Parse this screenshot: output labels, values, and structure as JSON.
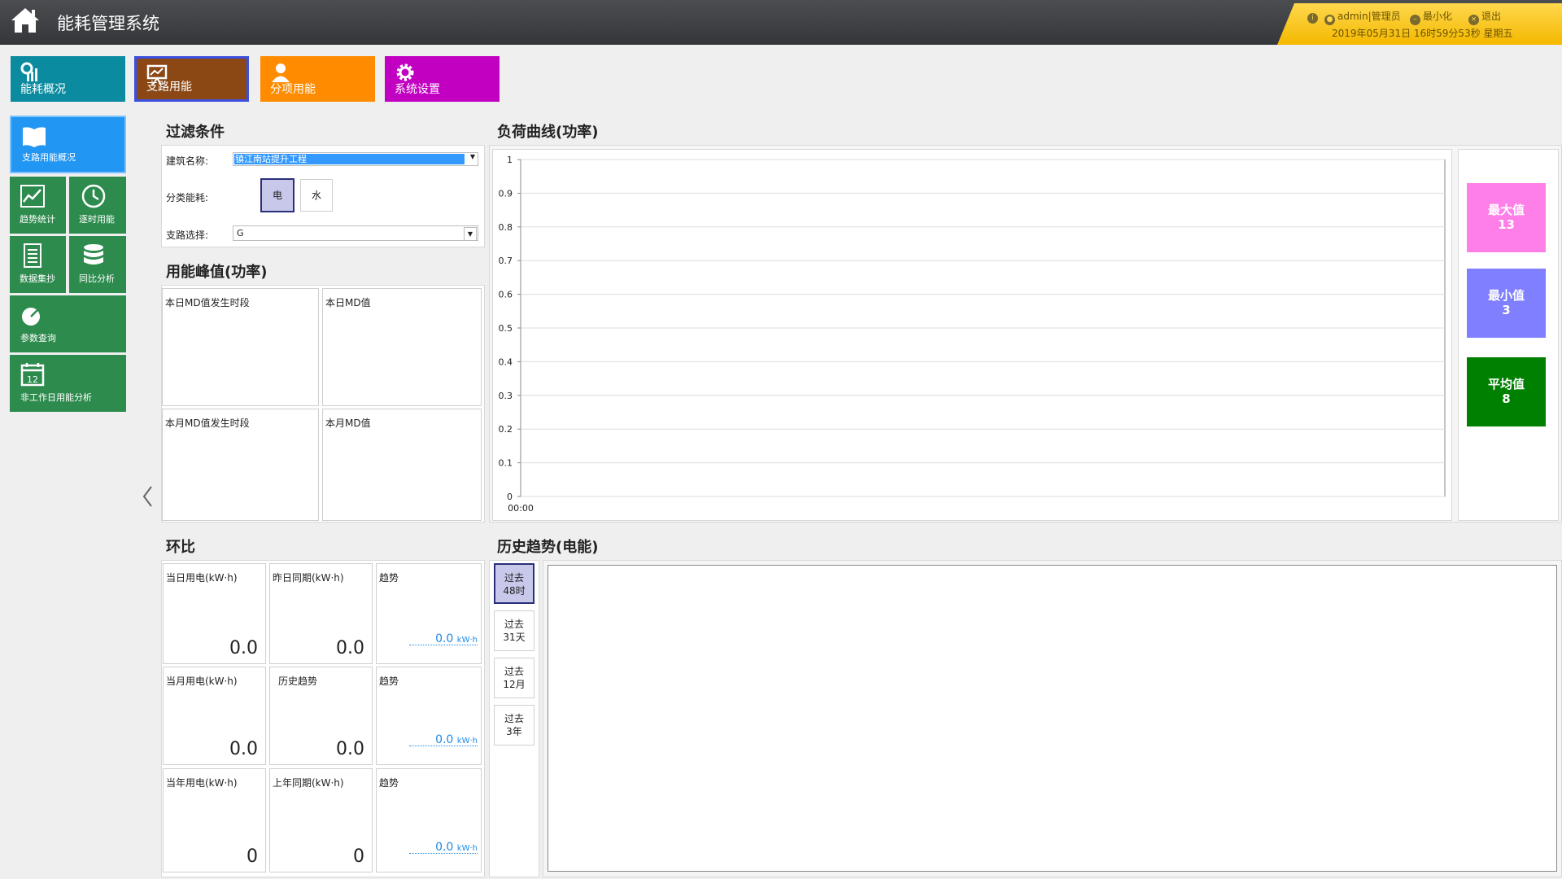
{
  "header": {
    "title": "能耗管理系统",
    "user": "admin|管理员",
    "minimize": "最小化",
    "logout": "退出",
    "datetime": "2019年05月31日 16时59分53秒 星期五"
  },
  "top_tabs": [
    {
      "label": "能耗概况"
    },
    {
      "label": "支路用能"
    },
    {
      "label": "分项用能"
    },
    {
      "label": "系统设置"
    }
  ],
  "side_menu": [
    {
      "label": "支路用能概况"
    },
    {
      "label": "趋势统计"
    },
    {
      "label": "逐时用能"
    },
    {
      "label": "数据集抄"
    },
    {
      "label": "同比分析"
    },
    {
      "label": "参数查询"
    },
    {
      "label": "非工作日用能分析"
    }
  ],
  "calendar_day": "12",
  "filter": {
    "title": "过滤条件",
    "building_label": "建筑名称:",
    "building_value": "镇江南站提升工程",
    "category_label": "分类能耗:",
    "elec": "电",
    "water": "水",
    "branch_label": "支路选择:",
    "branch_value": "G"
  },
  "peak": {
    "title": "用能峰值(功率)",
    "cells": [
      "本日MD值发生时段",
      "本日MD值",
      "本月MD值发生时段",
      "本月MD值"
    ]
  },
  "load_curve": {
    "title": "负荷曲线(功率)"
  },
  "chart_data": {
    "type": "line",
    "title": "",
    "xlabel": "",
    "ylabel": "",
    "x": [
      "00:00"
    ],
    "yticks": [
      "0",
      "0.1",
      "0.2",
      "0.3",
      "0.4",
      "0.5",
      "0.6",
      "0.7",
      "0.8",
      "0.9",
      "1"
    ],
    "ylim": [
      0,
      1
    ],
    "grid": true,
    "series": []
  },
  "stats": {
    "max_label": "最大值",
    "max_value": "13",
    "min_label": "最小值",
    "min_value": "3",
    "avg_label": "平均值",
    "avg_value": "8"
  },
  "ratio": {
    "title": "环比",
    "rows": [
      {
        "a_label": "当日用电(kW·h)",
        "a_value": "0.0",
        "b_label": "昨日同期(kW·h)",
        "b_value": "0.0",
        "c_label": "趋势",
        "c_value": "0.0",
        "c_unit": "kW·h"
      },
      {
        "a_label": "当月用电(kW·h)",
        "a_value": "0.0",
        "b_label": "历史趋势",
        "b_value": "0.0",
        "c_label": "趋势",
        "c_value": "0.0",
        "c_unit": "kW·h"
      },
      {
        "a_label": "当年用电(kW·h)",
        "a_value": "0",
        "b_label": "上年同期(kW·h)",
        "b_value": "0",
        "c_label": "趋势",
        "c_value": "0.0",
        "c_unit": "kW·h"
      }
    ]
  },
  "history": {
    "title": "历史趋势(电能)",
    "periods": [
      "过去\n48时",
      "过去\n31天",
      "过去\n12月",
      "过去\n3年"
    ]
  },
  "colors": {
    "header_bg": "#3d3f43",
    "user_panel": "#f8c81c",
    "tab_overview": "#0b8b9f",
    "tab_branch": "#8b4714",
    "tab_sub": "#ff8c00",
    "tab_settings": "#c200c2",
    "side_active": "#2196f3",
    "side_item": "#2e8b4e",
    "stat_max": "#ff7fe9",
    "stat_min": "#7f7fff",
    "stat_avg": "#008000"
  },
  "icons": {
    "home": "home-icon",
    "info": "info-icon",
    "user": "user-icon",
    "minimize": "minimize-icon",
    "logout": "close-circle-icon",
    "collapse": "chevron-left-icon"
  }
}
